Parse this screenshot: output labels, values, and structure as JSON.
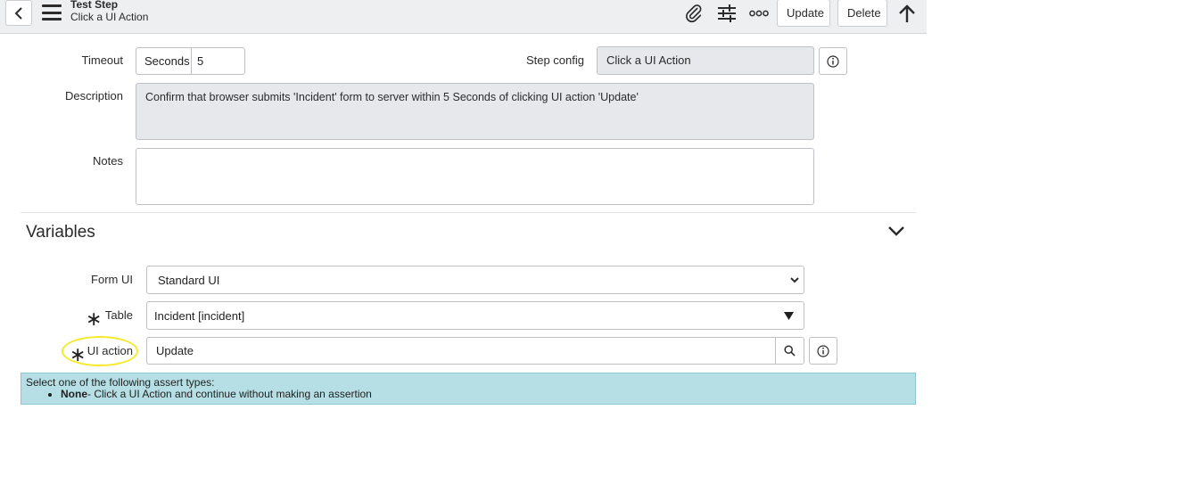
{
  "header": {
    "title": "Test Step",
    "subtitle": "Click a UI Action",
    "update_label": "Update",
    "delete_label": "Delete"
  },
  "form": {
    "timeout_label": "Timeout",
    "timeout_unit": "Seconds",
    "timeout_value": "5",
    "step_config_label": "Step config",
    "step_config_value": "Click a UI Action",
    "description_label": "Description",
    "description_value": "Confirm that browser submits 'Incident' form to server within 5 Seconds of clicking UI action 'Update'",
    "notes_label": "Notes",
    "notes_value": ""
  },
  "variables": {
    "title": "Variables",
    "form_ui_label": "Form UI",
    "form_ui_value": "Standard UI",
    "table_label": "Table",
    "table_value": "Incident [incident]",
    "ui_action_label": "UI action",
    "ui_action_value": "Update",
    "required_marker": "∗"
  },
  "info": {
    "intro": "Select one of the following assert types:",
    "items": [
      {
        "bold": "None",
        "text": "- Click a UI Action and continue without making an assertion"
      }
    ]
  },
  "colors": {
    "header_bg": "#eeeff1",
    "readonly_bg": "#e6e8eb",
    "info_bg": "#b5dfe5",
    "highlight": "#f5ea2a"
  },
  "icons": [
    "chevron-left-icon",
    "hamburger-menu-icon",
    "paperclip-icon",
    "sliders-icon",
    "more-icon",
    "arrow-up-icon",
    "info-icon",
    "chevron-down-icon",
    "search-icon",
    "dropdown-caret-icon"
  ]
}
